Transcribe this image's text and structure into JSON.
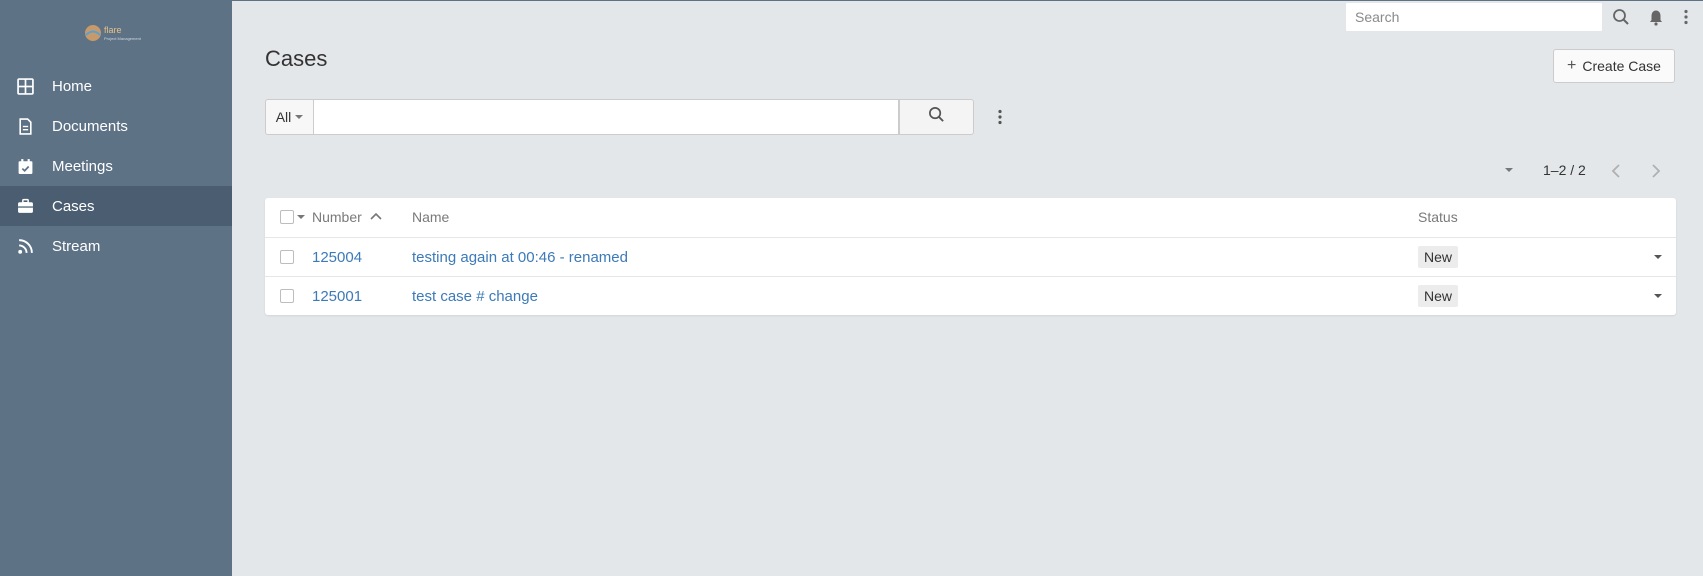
{
  "brand": {
    "logo_text": "flare",
    "logo_subtext": "Project Management"
  },
  "sidebar": {
    "items": [
      {
        "label": "Home",
        "icon": "grid-icon"
      },
      {
        "label": "Documents",
        "icon": "document-icon"
      },
      {
        "label": "Meetings",
        "icon": "calendar-check-icon"
      },
      {
        "label": "Cases",
        "icon": "briefcase-icon",
        "active": true
      },
      {
        "label": "Stream",
        "icon": "rss-icon"
      }
    ]
  },
  "topbar": {
    "search_placeholder": "Search"
  },
  "page": {
    "title": "Cases",
    "create_label": "Create Case"
  },
  "search": {
    "filter_label": "All",
    "query": ""
  },
  "pager": {
    "range_text": "1–2 / 2"
  },
  "table": {
    "columns": {
      "number": "Number",
      "name": "Name",
      "status": "Status"
    },
    "rows": [
      {
        "number": "125004",
        "name": "testing again at 00:46 - renamed",
        "status": "New"
      },
      {
        "number": "125001",
        "name": "test case # change",
        "status": "New"
      }
    ]
  },
  "colors": {
    "sidebar": "#5e7286",
    "sidebar_active": "#4b5e71",
    "link": "#3c7ab8",
    "background": "#e4e7ea"
  }
}
